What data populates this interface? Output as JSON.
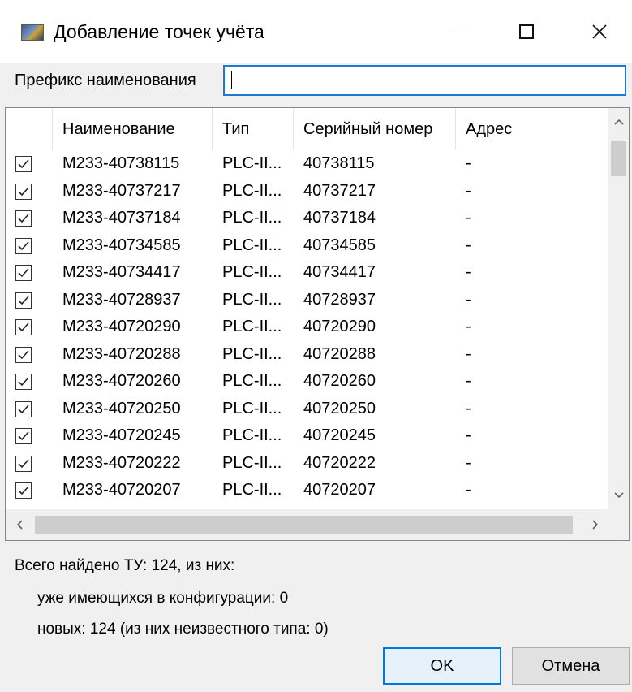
{
  "window": {
    "title": "Добавление точек учёта"
  },
  "prefix": {
    "label": "Префикс наименования",
    "value": ""
  },
  "table": {
    "columns": [
      "Наименование",
      "Тип",
      "Серийный номер",
      "Адрес"
    ],
    "rows": [
      {
        "checked": true,
        "name": "M233-40738115",
        "type": "PLC-II...",
        "serial": "40738115",
        "address": "-"
      },
      {
        "checked": true,
        "name": "M233-40737217",
        "type": "PLC-II...",
        "serial": "40737217",
        "address": "-"
      },
      {
        "checked": true,
        "name": "M233-40737184",
        "type": "PLC-II...",
        "serial": "40737184",
        "address": "-"
      },
      {
        "checked": true,
        "name": "M233-40734585",
        "type": "PLC-II...",
        "serial": "40734585",
        "address": "-"
      },
      {
        "checked": true,
        "name": "M233-40734417",
        "type": "PLC-II...",
        "serial": "40734417",
        "address": "-"
      },
      {
        "checked": true,
        "name": "M233-40728937",
        "type": "PLC-II...",
        "serial": "40728937",
        "address": "-"
      },
      {
        "checked": true,
        "name": "M233-40720290",
        "type": "PLC-II...",
        "serial": "40720290",
        "address": "-"
      },
      {
        "checked": true,
        "name": "M233-40720288",
        "type": "PLC-II...",
        "serial": "40720288",
        "address": "-"
      },
      {
        "checked": true,
        "name": "M233-40720260",
        "type": "PLC-II...",
        "serial": "40720260",
        "address": "-"
      },
      {
        "checked": true,
        "name": "M233-40720250",
        "type": "PLC-II...",
        "serial": "40720250",
        "address": "-"
      },
      {
        "checked": true,
        "name": "M233-40720245",
        "type": "PLC-II...",
        "serial": "40720245",
        "address": "-"
      },
      {
        "checked": true,
        "name": "M233-40720222",
        "type": "PLC-II...",
        "serial": "40720222",
        "address": "-"
      },
      {
        "checked": true,
        "name": "M233-40720207",
        "type": "PLC-II...",
        "serial": "40720207",
        "address": "-"
      }
    ]
  },
  "summary": {
    "total": "Всего найдено ТУ: 124, из них:",
    "existing": "уже имеющихся в конфигурации: 0",
    "new": "новых: 124 (из них неизвестного типа: 0)"
  },
  "buttons": {
    "ok": "OK",
    "cancel": "Отмена"
  },
  "colors": {
    "accent": "#0078d7",
    "window_bg": "#f0f0f0"
  }
}
